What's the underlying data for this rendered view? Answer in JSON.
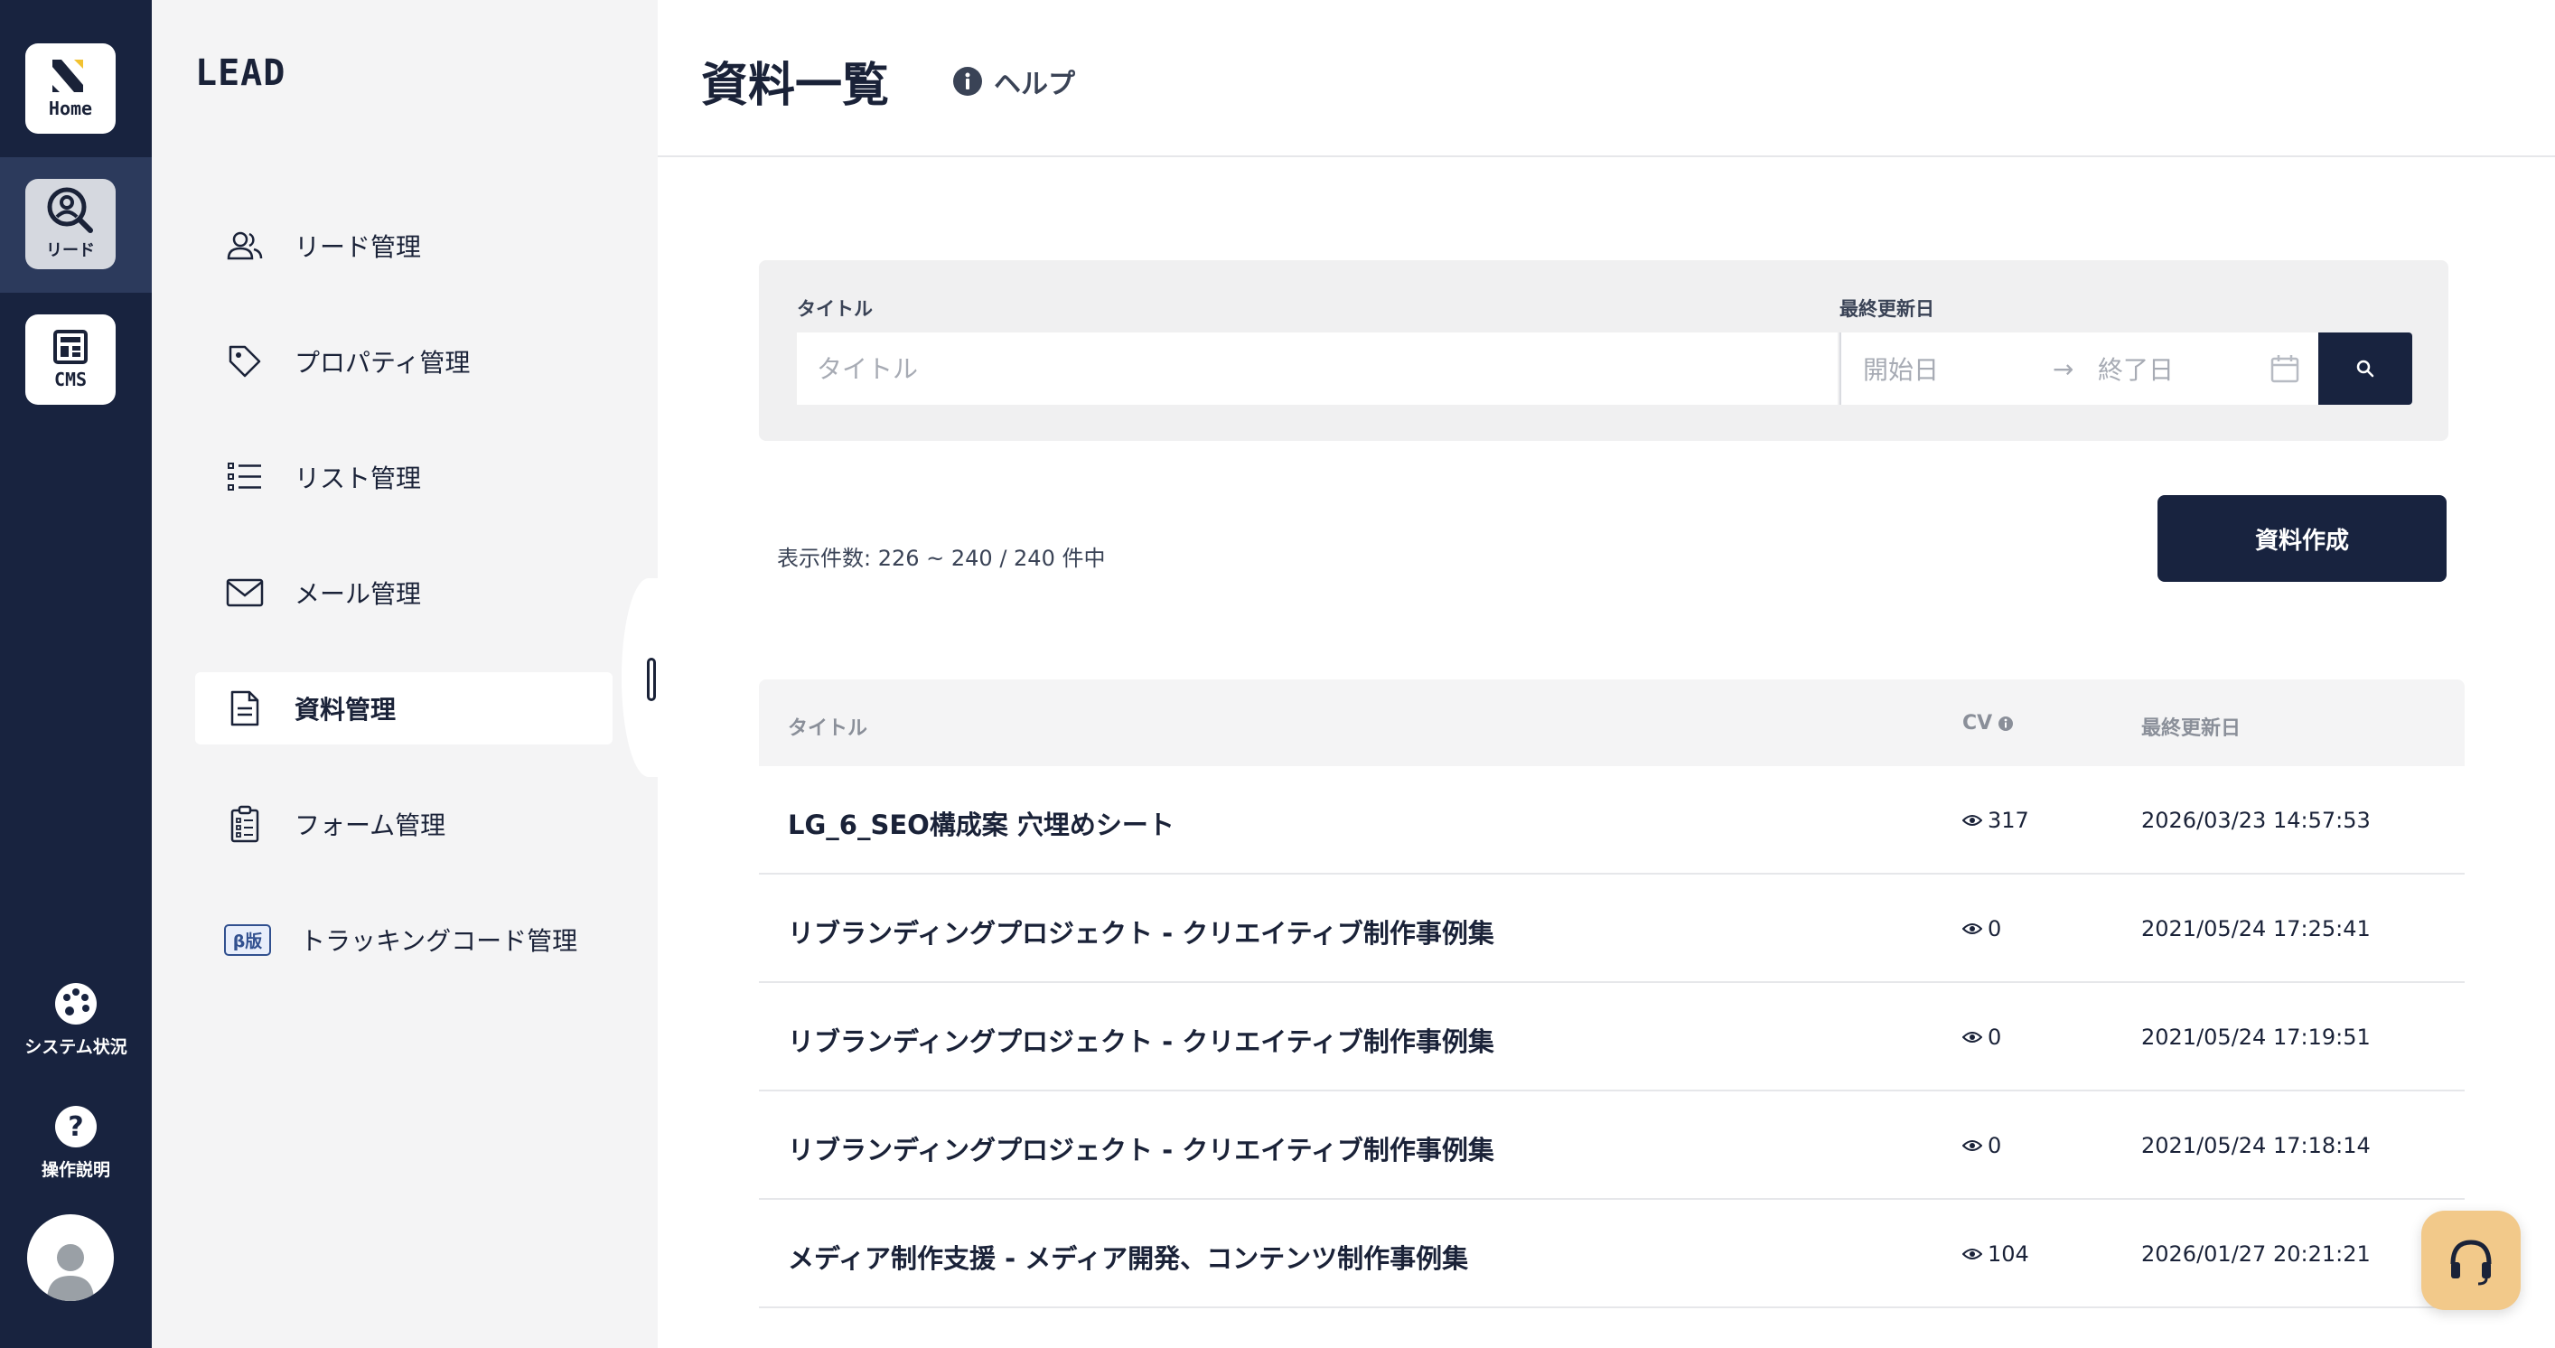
{
  "rail": {
    "home_label": "Home",
    "lead_label": "リード",
    "cms_label": "CMS",
    "system_label": "システム状況",
    "help_label": "操作説明"
  },
  "sidebar": {
    "brand": "LEAD",
    "items": [
      {
        "label": "リード管理",
        "icon": "users-icon"
      },
      {
        "label": "プロパティ管理",
        "icon": "tag-icon"
      },
      {
        "label": "リスト管理",
        "icon": "list-icon"
      },
      {
        "label": "メール管理",
        "icon": "mail-icon"
      },
      {
        "label": "資料管理",
        "icon": "document-icon",
        "active": true
      },
      {
        "label": "フォーム管理",
        "icon": "clipboard-icon"
      },
      {
        "label": "トラッキングコード管理",
        "badge": "β版"
      }
    ]
  },
  "header": {
    "title": "資料一覧",
    "help": "ヘルプ"
  },
  "filter": {
    "title_label": "タイトル",
    "title_placeholder": "タイトル",
    "date_label": "最終更新日",
    "start_placeholder": "開始日",
    "arrow": "→",
    "end_placeholder": "終了日"
  },
  "list": {
    "count_text": "表示件数: 226 ~ 240 / 240 件中",
    "create_label": "資料作成",
    "columns": {
      "title": "タイトル",
      "cv": "CV",
      "updated": "最終更新日"
    },
    "rows": [
      {
        "title": "LG_6_SEO構成案 穴埋めシート",
        "cv": "317",
        "updated": "2026/03/23 14:57:53"
      },
      {
        "title": "リブランディングプロジェクト - クリエイティブ制作事例集",
        "cv": "0",
        "updated": "2021/05/24 17:25:41"
      },
      {
        "title": "リブランディングプロジェクト - クリエイティブ制作事例集",
        "cv": "0",
        "updated": "2021/05/24 17:19:51"
      },
      {
        "title": "リブランディングプロジェクト - クリエイティブ制作事例集",
        "cv": "0",
        "updated": "2021/05/24 17:18:14"
      },
      {
        "title": "メディア制作支援 - メディア開発、コンテンツ制作事例集",
        "cv": "104",
        "updated": "2026/01/27 20:21:21"
      }
    ]
  },
  "colors": {
    "navy": "#18233f",
    "support": "#f2c98a"
  }
}
